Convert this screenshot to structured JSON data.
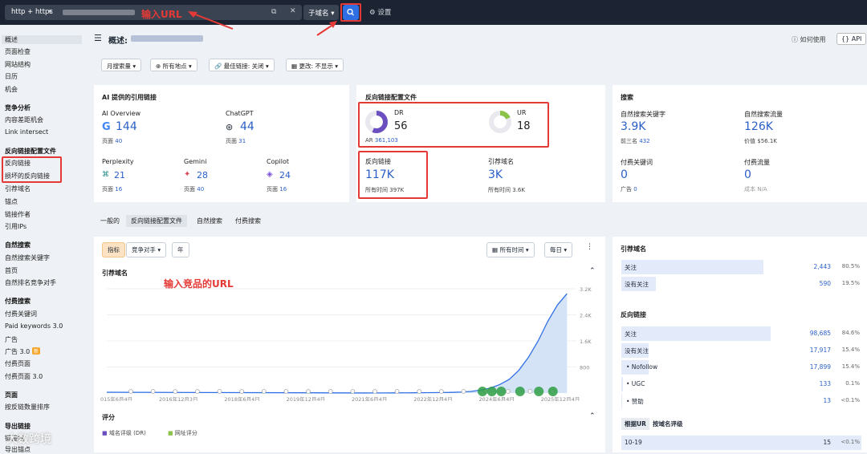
{
  "topbar": {
    "protocol": "http + https",
    "subdomain": "子域名",
    "settings": "设置",
    "annotation_url": "输入URL"
  },
  "sidebar": {
    "items": [
      "概述",
      "页面检查",
      "网站结构",
      "日历",
      "机会"
    ],
    "competitive_head": "竞争分析",
    "competitive": [
      "内容差距机会",
      "Link intersect"
    ],
    "backlinks_head": "反向链接配置文件",
    "backlinks": [
      "反向链接",
      "损坏的反向链接",
      "引荐域名",
      "锚点",
      "链接作者",
      "引用IPs"
    ],
    "organic_head": "自然搜索",
    "organic": [
      "自然搜索关键字",
      "首页",
      "自然排名竞争对手"
    ],
    "paid_head": "付费搜索",
    "paid": [
      "付费关键词",
      "Paid keywords 3.0",
      "广告",
      "广告 3.0",
      "付费页面",
      "付费页面 3.0"
    ],
    "pages_head": "页面",
    "pages": [
      "按反链数量排序"
    ],
    "outgoing_head": "导出链接",
    "outgoing": [
      "链接域",
      "导出锚点"
    ],
    "new_badge": "新"
  },
  "header": {
    "title": "概述:",
    "help": "如何使用",
    "api": "API"
  },
  "filters": [
    "月搜索量",
    "所有地点",
    "最佳链接: 关闭",
    "更改: 不显示"
  ],
  "ai_card": {
    "title": "AI 提供的引用链接",
    "items": [
      {
        "name": "AI Overview",
        "value": "144",
        "sub_label": "页面",
        "sub_value": "40"
      },
      {
        "name": "ChatGPT",
        "value": "44",
        "sub_label": "页面",
        "sub_value": "31"
      },
      {
        "name": "Perplexity",
        "value": "21",
        "sub_label": "页面",
        "sub_value": "16"
      },
      {
        "name": "Gemini",
        "value": "28",
        "sub_label": "页面",
        "sub_value": "40"
      },
      {
        "name": "Copilot",
        "value": "24",
        "sub_label": "页面",
        "sub_value": "16"
      }
    ]
  },
  "backlink_card": {
    "title": "反向链接配置文件",
    "dr_label": "DR",
    "dr_value": "56",
    "ar_label": "AR",
    "ar_value": "361,103",
    "ur_label": "UR",
    "ur_value": "18",
    "bl_label": "反向链接",
    "bl_value": "117K",
    "bl_sub_label": "所有时间",
    "bl_sub_value": "397K",
    "rd_label": "引荐域名",
    "rd_value": "3K",
    "rd_sub_label": "所有时间",
    "rd_sub_value": "3.6K",
    "dr_fraction": 0.56,
    "ur_fraction": 0.18
  },
  "search_card": {
    "title": "搜索",
    "org_kw_label": "自然搜索关键字",
    "org_kw_value": "3.9K",
    "org_kw_sub_label": "前三名",
    "org_kw_sub_value": "432",
    "org_tr_label": "自然搜索流量",
    "org_tr_value": "126K",
    "org_tr_sub_label": "价值",
    "org_tr_sub_value": "$56.1K",
    "paid_kw_label": "付费关键词",
    "paid_kw_value": "0",
    "paid_kw_sub_label": "广告",
    "paid_kw_sub_value": "0",
    "paid_tr_label": "付费流量",
    "paid_tr_value": "0",
    "paid_tr_sub_label": "成本",
    "paid_tr_sub_value": "N/A"
  },
  "tabs": [
    "一般的",
    "反向链接配置文件",
    "自然搜索",
    "付费搜索"
  ],
  "chart_controls": {
    "metric": "指标",
    "competitors": "竞争对手",
    "year": "年",
    "all_time": "所有时间",
    "daily": "每日",
    "annotation": "输入竞品的URL"
  },
  "chart_data": {
    "type": "line",
    "title": "引荐域名",
    "x": [
      "2015年6月4日",
      "2016年12月3日",
      "2018年6月4日",
      "2019年12月4日",
      "2021年6月4日",
      "2022年12月4日",
      "2024年6月4日",
      "2025年12月4日"
    ],
    "y_ticks": [
      "800",
      "1.6K",
      "2.4K",
      "3.2K"
    ],
    "ylim": [
      0,
      3200
    ],
    "series": [
      {
        "values": [
          2,
          3,
          4,
          5,
          6,
          8,
          10,
          12,
          15,
          20,
          30,
          50,
          90,
          150,
          260,
          420,
          700,
          1100,
          1600,
          2200,
          2700,
          3050
        ]
      }
    ]
  },
  "score_section": {
    "title": "评分",
    "legend": [
      "域名评级 (DR)",
      "网址评分"
    ]
  },
  "right_panel": {
    "rd_title": "引荐域名",
    "rd_rows": [
      {
        "label": "关注",
        "value": "2,443",
        "pct": "80.5%",
        "frac": 0.805
      },
      {
        "label": "没有关注",
        "value": "590",
        "pct": "19.5%",
        "frac": 0.195
      }
    ],
    "bl_title": "反向链接",
    "bl_rows": [
      {
        "label": "关注",
        "value": "98,685",
        "pct": "84.6%",
        "frac": 0.846
      },
      {
        "label": "没有关注",
        "value": "17,917",
        "pct": "15.4%",
        "frac": 0.154
      },
      {
        "label": "Nofollow",
        "value": "17,899",
        "pct": "15.4%",
        "frac": 0.154
      },
      {
        "label": "UGC",
        "value": "133",
        "pct": "0.1%",
        "frac": 0.01
      },
      {
        "label": "赞助",
        "value": "13",
        "pct": "<0.1%",
        "frac": 0.005
      }
    ],
    "tab_a": "根据UR",
    "tab_b": "按域名评级",
    "range_row": {
      "label": "10-19",
      "value": "15",
      "pct": "<0.1%"
    }
  },
  "watermark": "大数跨境"
}
